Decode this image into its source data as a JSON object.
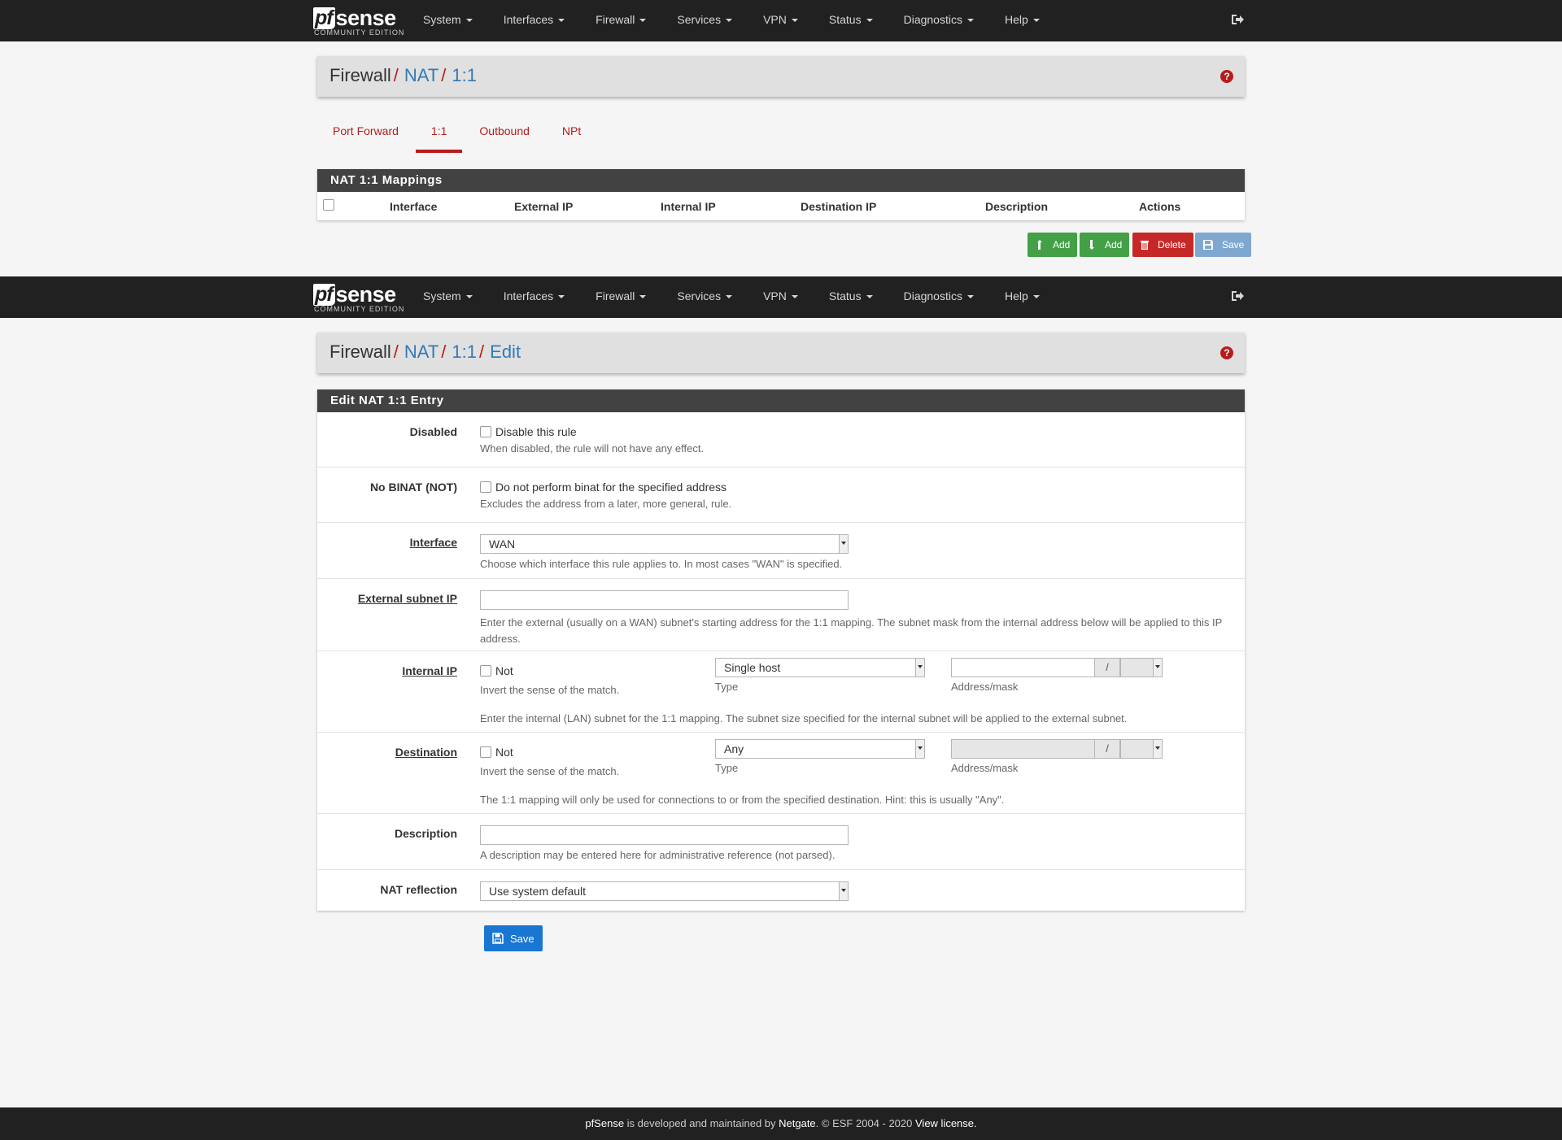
{
  "nav": {
    "logo_pf": "pf",
    "logo_sense": "sense",
    "logo_sub": "COMMUNITY EDITION",
    "items": [
      "System",
      "Interfaces",
      "Firewall",
      "Services",
      "VPN",
      "Status",
      "Diagnostics",
      "Help"
    ]
  },
  "page1": {
    "breadcrumb": {
      "root": "Firewall",
      "sep": "/",
      "links": [
        "NAT",
        "1:1"
      ]
    },
    "tabs": [
      {
        "label": "Port Forward",
        "active": false
      },
      {
        "label": "1:1",
        "active": true
      },
      {
        "label": "Outbound",
        "active": false
      },
      {
        "label": "NPt",
        "active": false
      }
    ],
    "panel_title": "NAT 1:1 Mappings",
    "columns": [
      "Interface",
      "External IP",
      "Internal IP",
      "Destination IP",
      "Description",
      "Actions"
    ],
    "buttons": {
      "add_top": "Add",
      "add_bottom": "Add",
      "delete": "Delete",
      "save": "Save"
    }
  },
  "page2": {
    "breadcrumb": {
      "root": "Firewall",
      "sep": "/",
      "links": [
        "NAT",
        "1:1",
        "Edit"
      ]
    },
    "panel_title": "Edit NAT 1:1 Entry",
    "disabled": {
      "label": "Disabled",
      "checkbox_label": "Disable this rule",
      "help": "When disabled, the rule will not have any effect."
    },
    "nobinat": {
      "label": "No BINAT (NOT)",
      "checkbox_label": "Do not perform binat for the specified address",
      "help": "Excludes the address from a later, more general, rule."
    },
    "interface": {
      "label": "Interface",
      "value": "WAN",
      "help": "Choose which interface this rule applies to. In most cases \"WAN\" is specified."
    },
    "external": {
      "label": "External subnet IP",
      "value": "",
      "help": "Enter the external (usually on a WAN) subnet's starting address for the 1:1 mapping. The subnet mask from the internal address below will be applied to this IP address."
    },
    "internal": {
      "label": "Internal IP",
      "not_label": "Not",
      "not_help": "Invert the sense of the match.",
      "type_value": "Single host",
      "type_label": "Type",
      "addr_label": "Address/mask",
      "slash": "/",
      "help": "Enter the internal (LAN) subnet for the 1:1 mapping. The subnet size specified for the internal subnet will be applied to the external subnet."
    },
    "destination": {
      "label": "Destination",
      "not_label": "Not",
      "not_help": "Invert the sense of the match.",
      "type_value": "Any",
      "type_label": "Type",
      "addr_label": "Address/mask",
      "slash": "/",
      "help": "The 1:1 mapping will only be used for connections to or from the specified destination. Hint: this is usually \"Any\"."
    },
    "description": {
      "label": "Description",
      "value": "",
      "help": "A description may be entered here for administrative reference (not parsed)."
    },
    "reflection": {
      "label": "NAT reflection",
      "value": "Use system default"
    },
    "save_label": "Save"
  },
  "footer": {
    "brand": "pfSense",
    "text1": " is developed and maintained by ",
    "company": "Netgate",
    "text2": ". © ESF 2004 - 2020 ",
    "license": "View license."
  },
  "colors": {
    "navbar": "#212121",
    "accent_red": "#b71c1c",
    "link_blue": "#337ab7",
    "panel_heading": "#424242",
    "save_blue": "#1976d2",
    "add_green": "#43a047"
  }
}
